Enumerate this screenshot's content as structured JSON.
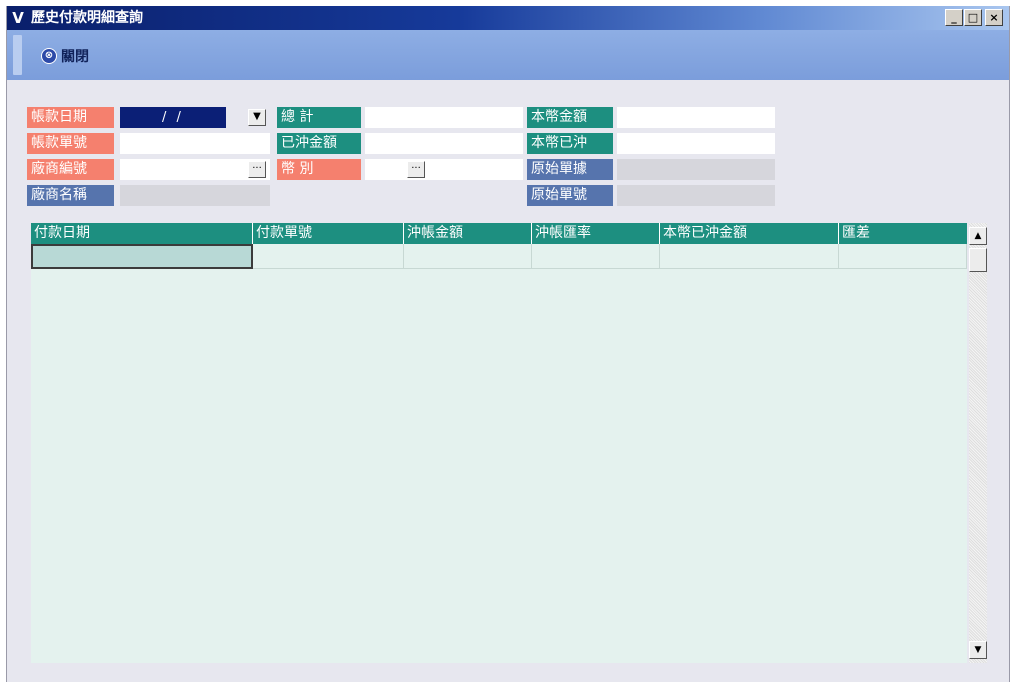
{
  "window": {
    "title": "歷史付款明細查詢",
    "logo_glyph": "V",
    "min_glyph": "_",
    "max_glyph": "□",
    "close_glyph": "×"
  },
  "toolbar": {
    "close_label": "關閉",
    "close_icon_glyph": "⊗"
  },
  "form": {
    "account_date": {
      "label": "帳款日期",
      "value": "/ /",
      "dropdown_glyph": "▼"
    },
    "account_no": {
      "label": "帳款單號",
      "value": ""
    },
    "vendor_no": {
      "label": "廠商編號",
      "value": "",
      "lookup_glyph": "···"
    },
    "vendor_name": {
      "label": "廠商名稱",
      "value": ""
    },
    "total": {
      "label": "總 計",
      "value": ""
    },
    "offset_amount": {
      "label": "已沖金額",
      "value": ""
    },
    "currency": {
      "label": "幣 別",
      "value": "",
      "lookup_glyph": "···"
    },
    "local_amount": {
      "label": "本幣金額",
      "value": ""
    },
    "local_offset": {
      "label": "本幣已沖",
      "value": ""
    },
    "source_doc": {
      "label": "原始單據",
      "value": ""
    },
    "source_no": {
      "label": "原始單號",
      "value": ""
    }
  },
  "grid": {
    "columns": [
      "付款日期",
      "付款單號",
      "沖帳金額",
      "沖帳匯率",
      "本幣已沖金額",
      "匯差"
    ],
    "rows": [
      [
        "",
        "",
        "",
        "",
        "",
        ""
      ]
    ],
    "scroll_up_glyph": "▲",
    "scroll_down_glyph": "▼"
  },
  "colors": {
    "required_label": "#f5806e",
    "teal_label": "#1d8f80",
    "blue_label": "#5674ad",
    "grid_bg": "#e4f2ee"
  }
}
